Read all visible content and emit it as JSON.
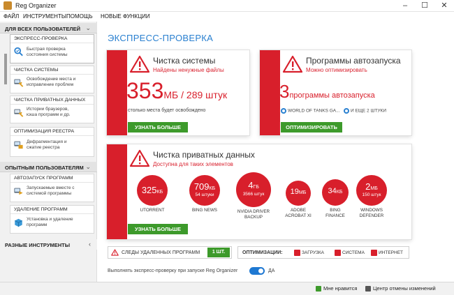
{
  "window": {
    "title": "Reg Organizer",
    "controls": [
      "–",
      "☐",
      "✕"
    ]
  },
  "menu": [
    "ФАЙЛ",
    "ИНСТРУМЕНТЫ",
    "ПОМОЩЬ",
    "НОВЫЕ ФУНКЦИИ"
  ],
  "sidebar": {
    "group1": "ДЛЯ ВСЕХ ПОЛЬЗОВАТЕЛЕЙ",
    "group2": "ОПЫТНЫМ ПОЛЬЗОВАТЕЛЯМ",
    "group3": "РАЗНЫЕ ИНСТРУМЕНТЫ",
    "items": [
      {
        "title": "ЭКСПРЕСС-ПРОВЕРКА",
        "desc1": "Быстрая проверка",
        "desc2": "состояния системы",
        "icon": "magnifier-check-icon"
      },
      {
        "title": "ЧИСТКА СИСТЕМЫ",
        "desc1": "Освобождение места и",
        "desc2": "исправление проблем",
        "icon": "broom-icon"
      },
      {
        "title": "ЧИСТКА ПРИВАТНЫХ ДАННЫХ",
        "desc1": "Истории браузеров,",
        "desc2": "кэша программ и др.",
        "icon": "privacy-broom-icon"
      },
      {
        "title": "ОПТИМИЗАЦИЯ РЕЕСТРА",
        "desc1": "Дефрагментация и",
        "desc2": "сжатие реестра",
        "icon": "registry-icon"
      },
      {
        "title": "АВТОЗАПУСК ПРОГРАММ",
        "desc1": "Запускаемые вместе с",
        "desc2": "системой программы",
        "icon": "autorun-icon"
      },
      {
        "title": "УДАЛЕНИЕ ПРОГРАММ",
        "desc1": "Установка и удаление",
        "desc2": "программ",
        "icon": "uninstall-box-icon"
      }
    ]
  },
  "main": {
    "title": "ЭКСПРЕСС-ПРОВЕРКА",
    "card1": {
      "title": "Чистка системы",
      "subtitle": "Найдены ненужные файлы",
      "big_value": "353",
      "big_unit": "МБ / 289 штук",
      "desc": "столько места будет освобождено",
      "button": "УЗНАТЬ БОЛЬШЕ"
    },
    "card2": {
      "title": "Программы автозапуска",
      "subtitle": "Можно оптимизировать",
      "big_value": "3",
      "big_unit": "программы автозапуска",
      "item1": "WORLD OF TANKS GA...",
      "item2": "И ЕЩЕ 2 ШТУКИ",
      "button": "ОПТИМИЗИРОВАТЬ"
    },
    "card3": {
      "title": "Чистка приватных данных",
      "subtitle": "Доступна для таких элементов",
      "button": "УЗНАТЬ БОЛЬШЕ",
      "circles": [
        {
          "value": "325",
          "unit": "КБ",
          "sub": "",
          "label1": "UTORRENT",
          "label2": ""
        },
        {
          "value": "709",
          "unit": "КБ",
          "sub": "54 штуки",
          "label1": "BING NEWS",
          "label2": ""
        },
        {
          "value": "4",
          "unit": "ГБ",
          "sub": "3566 штук",
          "label1": "NVIDIA DRIVER",
          "label2": "BACKUP"
        },
        {
          "value": "19",
          "unit": "МБ",
          "sub": "",
          "label1": "ADOBE",
          "label2": "ACROBAT XI"
        },
        {
          "value": "34",
          "unit": "КБ",
          "sub": "",
          "label1": "BING",
          "label2": "FINANCE"
        },
        {
          "value": "2",
          "unit": "МБ",
          "sub": "150 штук",
          "label1": "WINDOWS",
          "label2": "DEFENDER"
        }
      ]
    },
    "traces": {
      "label": "СЛЕДЫ УДАЛЕННЫХ ПРОГРАММ",
      "count": "1 ШТ."
    },
    "optimization": {
      "label": "ОПТИМИЗАЦИИ:",
      "items": [
        "ЗАГРУЗКА",
        "СИСТЕМА",
        "ИНТЕРНЕТ"
      ]
    },
    "autorun_check": {
      "label": "Выполнять экспресс-проверку при запуске Reg Organizer",
      "state": "ДА"
    }
  },
  "statusbar": {
    "like": "Мне нравится",
    "undo": "Центр отмены изменений"
  },
  "colors": {
    "accent": "#d81f2b",
    "link": "#2a80d0",
    "green": "#3d9a2b"
  }
}
